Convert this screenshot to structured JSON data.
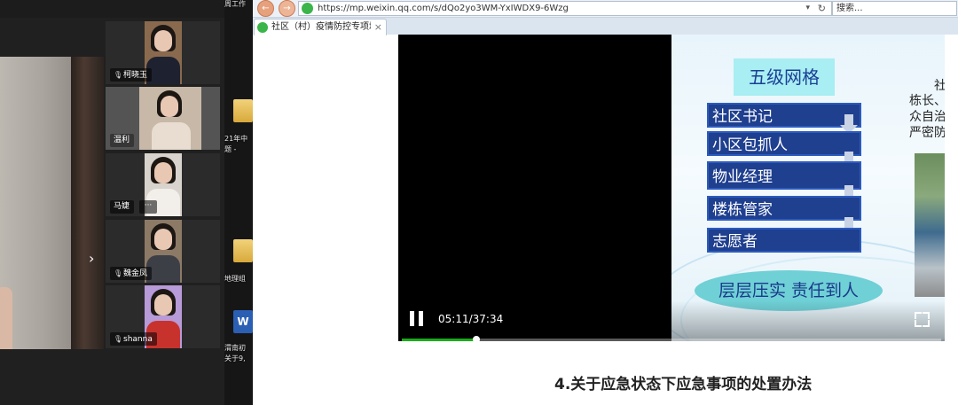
{
  "meeting": {
    "participants": [
      {
        "name": "柯晓玉",
        "active": false
      },
      {
        "name": "温利",
        "active": true
      },
      {
        "name": "马婕",
        "active": false
      },
      {
        "name": "魏金凤",
        "active": false
      },
      {
        "name": "shanna",
        "active": false
      }
    ],
    "more_label": "···",
    "next_arrow": "›"
  },
  "desktop": {
    "items": [
      {
        "label": "周工作",
        "icon": "folder-icon"
      },
      {
        "label": "21年中",
        "icon": "folder-icon"
      },
      {
        "label": "题 -",
        "icon": "folder-icon"
      },
      {
        "label": "地理组",
        "icon": "folder-icon"
      },
      {
        "label": "渭南初",
        "icon": "word-doc-icon"
      },
      {
        "label": "关于9,",
        "icon": "word-doc-icon"
      }
    ]
  },
  "browser": {
    "back_icon": "←",
    "forward_icon": "→",
    "url": "https://mp.weixin.qq.com/s/dQo2yo3WM-YxIWDX9-6Wzg",
    "dropdown_icon": "▾",
    "refresh_icon": "↻",
    "search_placeholder": "搜索...",
    "tab_title": "社区（村）疫情防控专项培...",
    "tab_close": "×"
  },
  "slide": {
    "title": "五级网格",
    "levels": [
      "社区书记",
      "小区包抓人",
      "物业经理",
      "楼栋管家",
      "志愿者"
    ],
    "slogan": "层层压实 责任到人",
    "side_text_lines": [
      "社",
      "栋长、",
      "众自治",
      "严密防"
    ]
  },
  "player": {
    "current_time": "05:11",
    "duration": "37:34",
    "time_display": "05:11/37:34",
    "progress_fraction": 0.138
  },
  "article": {
    "heading": "4.关于应急状态下应急事项的处置办法"
  },
  "colors": {
    "wechat_green": "#1aad19",
    "grid_title_bg": "#a8eef2",
    "grid_row_bg": "#1f3f8f",
    "slogan_bg": "#6fd0d6"
  }
}
